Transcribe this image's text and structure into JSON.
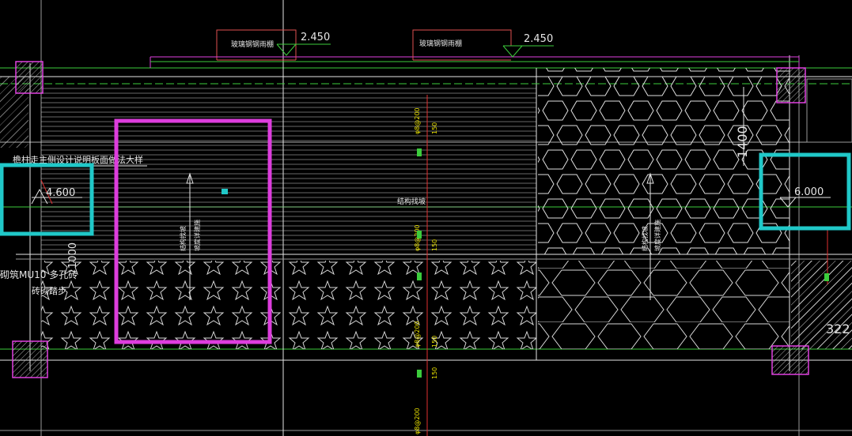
{
  "colors": {
    "background": "#000000",
    "line_white": "#e6e6e6",
    "line_green": "#3ccc3c",
    "line_gray": "#9a9a9a",
    "magenta": "#e040e0",
    "magenta_frame": "#dd3ddd",
    "cyan": "#20c8c8",
    "red": "#e03030",
    "yellow": "#e8e000"
  },
  "annotations": {
    "canopy_left_label": "玻璃钢钢雨棚",
    "canopy_right_label": "玻璃钢钢雨棚",
    "elevation_top_left": "2.450",
    "elevation_top_right": "2.450",
    "elevation_left": "4.600",
    "elevation_right": "6.000",
    "note_left_top": "檐柱走主侧设计说明板面做法大样",
    "note_left_bottom_1": "砌筑MU10 多孔砖",
    "note_left_bottom_2": "砖砌踏步",
    "center_label": "结构找坡",
    "vertical_label_left_1": "结构找坡",
    "vertical_label_left_2": "坡度详建施",
    "vertical_label_right_1": "结构找坡",
    "vertical_label_right_2": "坡度详建施",
    "right_vertical_dim": "1400",
    "left_vertical_dim": "1000",
    "partial_dim_right": "322",
    "rebar_labels": [
      "φ8@200",
      "φ8@200",
      "φ8@200",
      "φ8@200"
    ],
    "red_dims": [
      "150",
      "150",
      "150",
      "150"
    ]
  }
}
